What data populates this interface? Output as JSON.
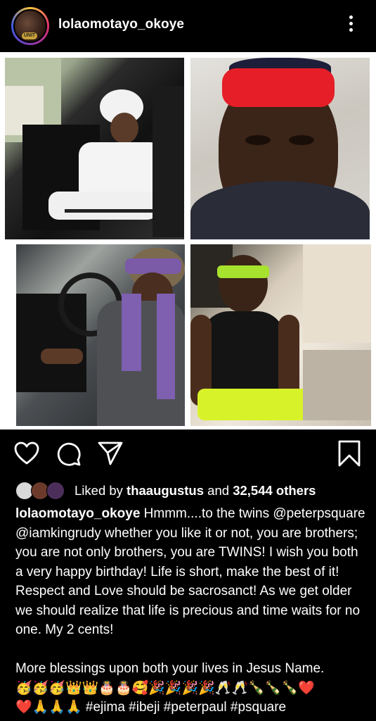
{
  "header": {
    "username": "lolaomotayo_okoye",
    "avatar_badge": "UNIT"
  },
  "actions": {
    "like_icon": "heart-icon",
    "comment_icon": "comment-icon",
    "share_icon": "send-icon",
    "save_icon": "bookmark-icon"
  },
  "likes": {
    "prefix": "Liked by ",
    "user": "thaaugustus",
    "joiner": " and ",
    "count": "32,544 others"
  },
  "caption": {
    "author": "lolaomotayo_okoye",
    "text": " Hmmm....to the twins @peterpsquare @iamkingrudy whether you like it or not, you are brothers; you are not only brothers, you are TWINS! I wish you both a very happy birthday! Life is short, make the best of it! Respect and Love should be sacrosanct! As we get older we should realize that life is precious and time waits for no one. My 2 cents!",
    "line2": "More blessings upon both your lives in Jesus Name.",
    "emojis": "🥳🥳🥳👑👑🎂🎂🥰🎉🎉🎉🎉🥂🥂🍾🍾🍾❤️",
    "emojis2": "❤️🙏🙏🙏",
    "hashtags": " #ejima #ibeji #peterpaul #psquare"
  },
  "colors": {
    "background": "#000000",
    "text": "#ffffff"
  }
}
